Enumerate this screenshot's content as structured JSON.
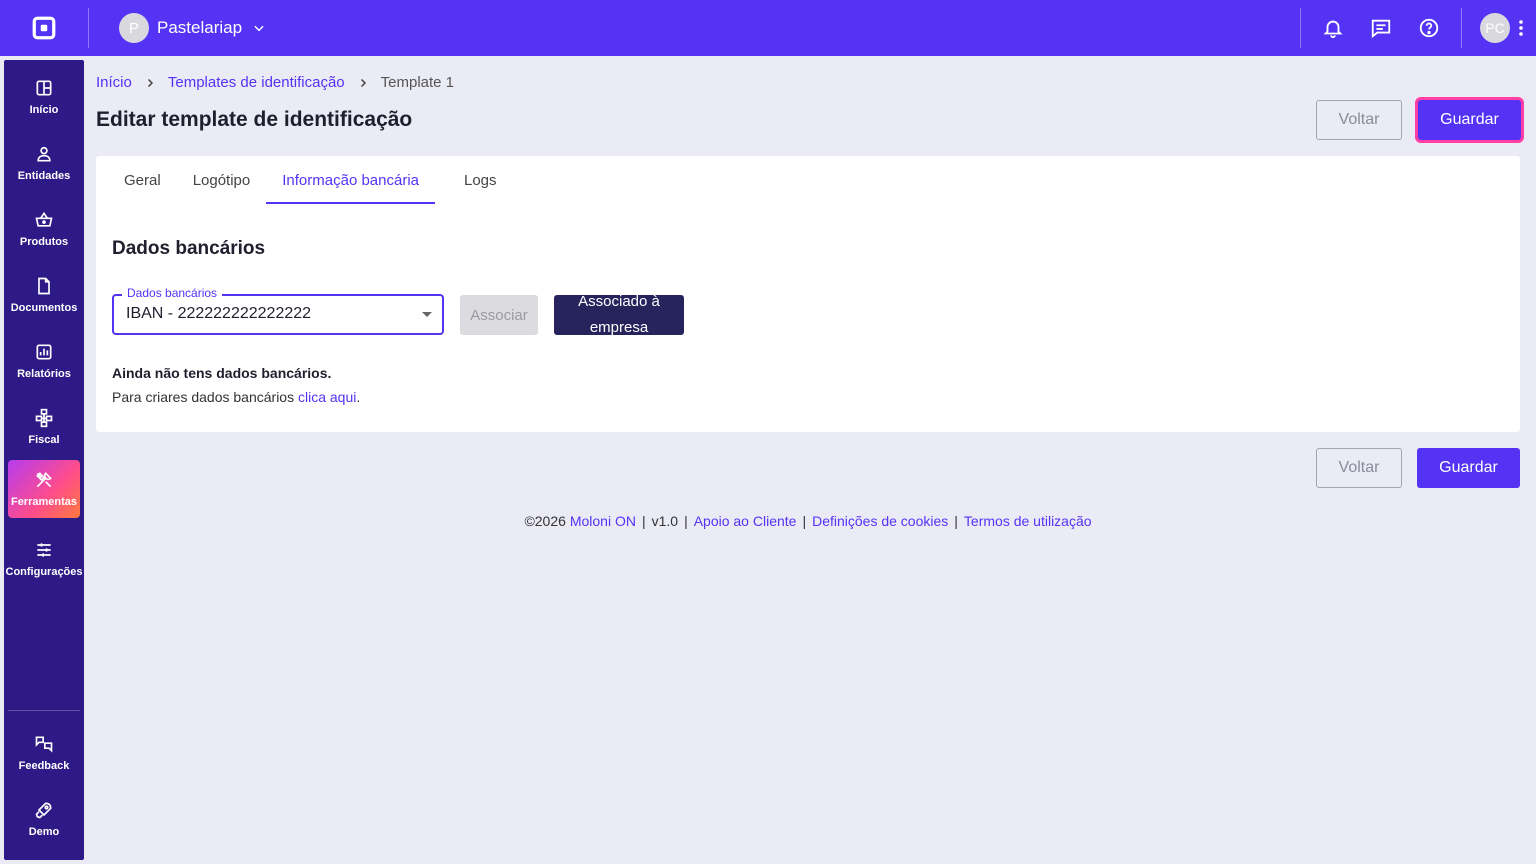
{
  "topbar": {
    "company_initial": "P",
    "company_name": "Pastelariap",
    "user_initials": "PC"
  },
  "sidebar": {
    "items": [
      {
        "label": "Início",
        "icon": "home-grid-icon"
      },
      {
        "label": "Entidades",
        "icon": "user-icon"
      },
      {
        "label": "Produtos",
        "icon": "basket-icon"
      },
      {
        "label": "Documentos",
        "icon": "document-icon"
      },
      {
        "label": "Relatórios",
        "icon": "chart-icon"
      },
      {
        "label": "Fiscal",
        "icon": "hierarchy-icon"
      },
      {
        "label": "Ferramentas",
        "icon": "tools-icon",
        "active": true
      },
      {
        "label": "Configurações",
        "icon": "sliders-icon"
      }
    ],
    "bottom": [
      {
        "label": "Feedback",
        "icon": "feedback-icon"
      },
      {
        "label": "Demo",
        "icon": "rocket-icon"
      }
    ]
  },
  "breadcrumb": {
    "home": "Início",
    "section": "Templates de identificação",
    "current": "Template 1"
  },
  "page": {
    "title": "Editar template de identificação",
    "back_label": "Voltar",
    "save_label": "Guardar"
  },
  "tabs": [
    {
      "label": "Geral"
    },
    {
      "label": "Logótipo"
    },
    {
      "label": "Informação bancária",
      "active": true
    },
    {
      "label": "Logs"
    }
  ],
  "bank": {
    "section_title": "Dados bancários",
    "select_label": "Dados bancários",
    "select_value": "IBAN - 222222222222222",
    "associate_label": "Associar",
    "associated_label": "Associado à empresa",
    "empty_title": "Ainda não tens dados bancários.",
    "empty_text": "Para criares dados bancários ",
    "empty_link": "clica aqui",
    "empty_end": "."
  },
  "footer": {
    "copyright": "©2026 ",
    "brand": "Moloni ON",
    "version": "v1.0",
    "support": "Apoio ao Cliente",
    "cookies": "Definições de cookies",
    "terms": "Termos de utilização"
  },
  "colors": {
    "primary": "#5433f5",
    "sidebar": "#2e1a86",
    "focus_ring": "#ff3ea5",
    "dark_button": "#27235c"
  }
}
